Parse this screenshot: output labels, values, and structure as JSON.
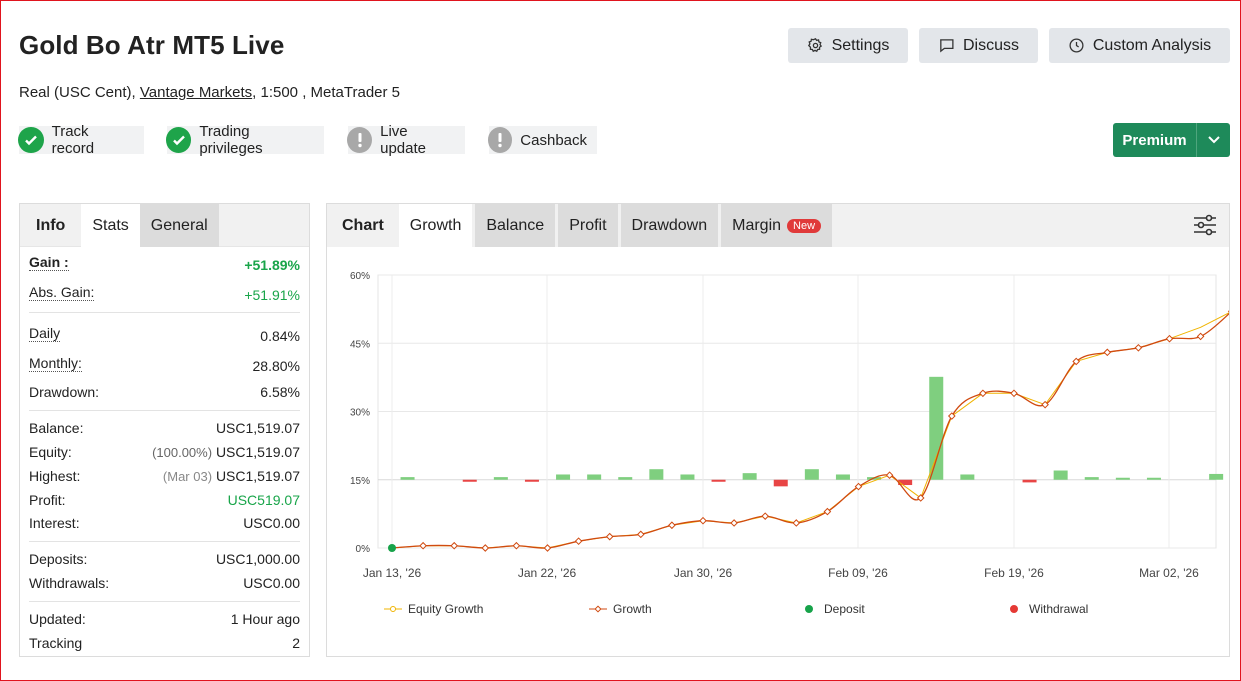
{
  "header": {
    "title": "Gold Bo Atr MT5 Live",
    "account_prefix": "Real (USC Cent), ",
    "broker": "Vantage Markets",
    "account_suffix": ", 1:500 , MetaTrader 5",
    "buttons": {
      "settings": {
        "label": "Settings",
        "icon": "gear-icon"
      },
      "discuss": {
        "label": "Discuss",
        "icon": "chat-icon"
      },
      "custom": {
        "label": "Custom Analysis",
        "icon": "clock-icon"
      }
    },
    "badges": [
      {
        "label": "Track record",
        "status": "ok"
      },
      {
        "label": "Trading privileges",
        "status": "ok"
      },
      {
        "label": "Live update",
        "status": "warn"
      },
      {
        "label": "Cashback",
        "status": "warn"
      }
    ],
    "premium_label": "Premium"
  },
  "stats_panel": {
    "tabs": {
      "info": "Info",
      "stats": "Stats",
      "general": "General"
    },
    "gain_label": "Gain :",
    "gain_value": "+51.89%",
    "abs_gain_label": "Abs. Gain:",
    "abs_gain_value": "+51.91%",
    "daily_label": "Daily",
    "daily_value": "0.84%",
    "monthly_label": "Monthly:",
    "monthly_value": "28.80%",
    "drawdown_label": "Drawdown:",
    "drawdown_value": "6.58%",
    "balance_label": "Balance:",
    "balance_value": "USC1,519.07",
    "equity_label": "Equity:",
    "equity_pct": "(100.00%)",
    "equity_value": "USC1,519.07",
    "highest_label": "Highest:",
    "highest_date": "(Mar 03)",
    "highest_value": "USC1,519.07",
    "profit_label": "Profit:",
    "profit_value": "USC519.07",
    "interest_label": "Interest:",
    "interest_value": "USC0.00",
    "deposits_label": "Deposits:",
    "deposits_value": "USC1,000.00",
    "withdrawals_label": "Withdrawals:",
    "withdrawals_value": "USC0.00",
    "updated_label": "Updated:",
    "updated_value": "1 Hour ago",
    "tracking_label": "Tracking",
    "tracking_value": "2"
  },
  "chart_panel": {
    "tabs": {
      "chart": "Chart",
      "growth": "Growth",
      "balance": "Balance",
      "profit": "Profit",
      "drawdown": "Drawdown",
      "margin": "Margin",
      "new_badge": "New"
    },
    "filter_icon": "sliders-icon"
  },
  "chart_data": {
    "type": "line",
    "ylim": [
      0,
      60
    ],
    "y_ticks": [
      "0%",
      "15%",
      "30%",
      "45%",
      "60%"
    ],
    "x_tick_labels": [
      "Jan 13, '26",
      "Jan 22, '26",
      "Jan 30, '26",
      "Feb 09, '26",
      "Feb 19, '26",
      "Mar 02, '26"
    ],
    "grid": true,
    "legend_position": "bottom",
    "legend": [
      {
        "name": "Equity Growth",
        "color": "#f0b400"
      },
      {
        "name": "Growth",
        "color": "#d04a10"
      },
      {
        "name": "Deposit",
        "color": "#17a34a"
      },
      {
        "name": "Withdrawal",
        "color": "#e53935"
      }
    ],
    "growth_series": [
      0,
      0.5,
      0.5,
      0,
      0.5,
      0,
      1.5,
      2.5,
      3,
      5,
      6,
      5.5,
      7,
      5.5,
      8,
      13.5,
      16,
      11,
      29,
      34,
      34,
      31.5,
      41,
      43,
      44,
      46,
      46.5,
      52
    ],
    "equity_series": [
      0,
      0.5,
      0.5,
      0,
      0.5,
      0,
      1.5,
      2.5,
      3,
      5,
      6,
      5.5,
      7,
      5.5,
      8,
      13.5,
      16,
      11,
      29,
      34,
      34,
      31.5,
      41,
      43,
      44,
      46,
      48.5,
      52
    ],
    "daily_bars": [
      1,
      0,
      -0.5,
      1,
      -0.5,
      2,
      2,
      1,
      4,
      2,
      -0.5,
      2.5,
      -2.5,
      4,
      2,
      1,
      -2,
      39,
      2,
      0,
      -1,
      3.5,
      1,
      0.5,
      0.5,
      0,
      2.2
    ],
    "deposit_points": [
      {
        "index": 0,
        "value": 0
      }
    ]
  }
}
